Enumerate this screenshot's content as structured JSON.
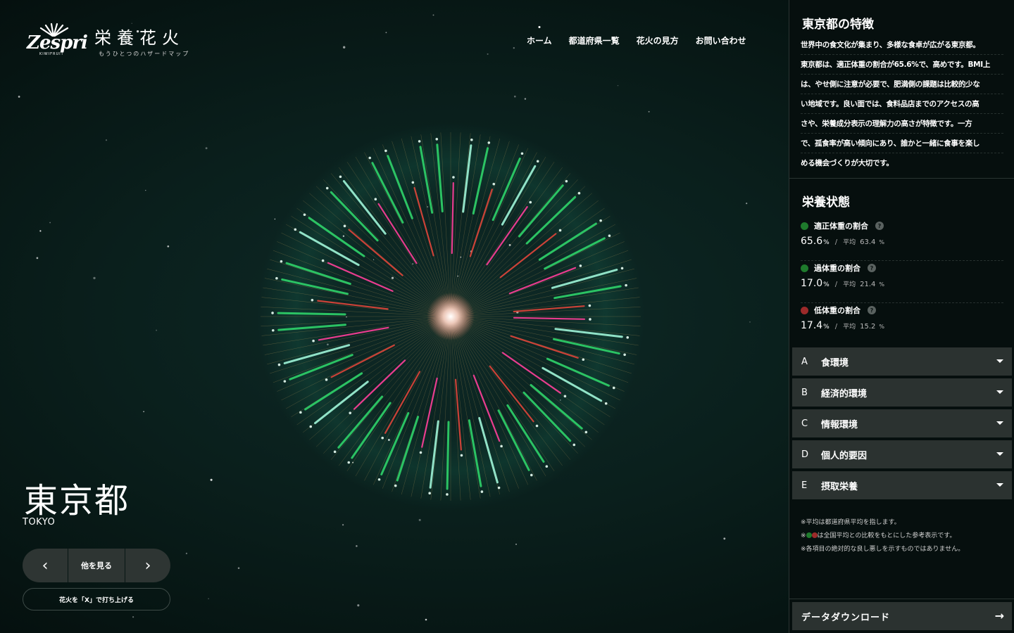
{
  "header": {
    "brand": "Zespri",
    "brand_sub": "KIWIFRUIT",
    "site_title": "栄養花火",
    "site_subtitle": "もうひとつのハザードマップ",
    "nav": [
      "ホーム",
      "都道府県一覧",
      "花火の見方",
      "お問い合わせ"
    ]
  },
  "prefecture": {
    "name": "東京都",
    "name_en": "TOKYO"
  },
  "controls": {
    "prev_icon": "‹",
    "more_label": "他を見る",
    "next_icon": "›",
    "launch_label": "花火を「X」で打ち上げる"
  },
  "panel": {
    "features_title": "東京都の特徴",
    "features_lines": [
      "世界中の食文化が集まり、多様な食卓が広がる東京都。",
      "東京都は、適正体重の割合が65.6%で、高めです。BMI上",
      "は、やせ側に注意が必要で、肥満側の課題は比較的少な",
      "い地域です。良い面では、食料品店までのアクセスの高",
      "さや、栄養成分表示の理解力の高さが特徴です。一方",
      "で、孤食率が高い傾向にあり、誰かと一緒に食事を楽し",
      "める機会づくりが大切です。"
    ],
    "nutrition_title": "栄養状態",
    "metrics": [
      {
        "label": "適正体重の割合",
        "value": "65.6",
        "unit": "%",
        "avg_label": "平均",
        "avg": "63.4",
        "avg_unit": "%",
        "color": "#1e7a2c"
      },
      {
        "label": "過体重の割合",
        "value": "17.0",
        "unit": "%",
        "avg_label": "平均",
        "avg": "21.4",
        "avg_unit": "%",
        "color": "#1e7a2c"
      },
      {
        "label": "低体重の割合",
        "value": "17.4",
        "unit": "%",
        "avg_label": "平均",
        "avg": "15.2",
        "avg_unit": "%",
        "color": "#9c2a2a"
      }
    ],
    "help_icon": "?",
    "sections": [
      {
        "key": "A",
        "label": "食環境"
      },
      {
        "key": "B",
        "label": "経済的環境"
      },
      {
        "key": "C",
        "label": "情報環境"
      },
      {
        "key": "D",
        "label": "個人的要因"
      },
      {
        "key": "E",
        "label": "摂取栄養"
      }
    ],
    "notes": [
      "※平均は都道府県平均を指します。",
      "は全国平均との比較をもとにした参考表示です。",
      "※各項目の絶対的な良し悪しを示すものではありません。"
    ],
    "notes_prefix": "※",
    "download_label": "データダウンロード",
    "download_icon": "→"
  },
  "colors": {
    "good": "#1e7a2c",
    "bad": "#9c2a2a",
    "button_bg": "#2b3230",
    "firework_green": "#2fd36a",
    "firework_teal": "#9ff5d8",
    "firework_red": "#e0453a",
    "firework_pink": "#ff3f9a"
  }
}
